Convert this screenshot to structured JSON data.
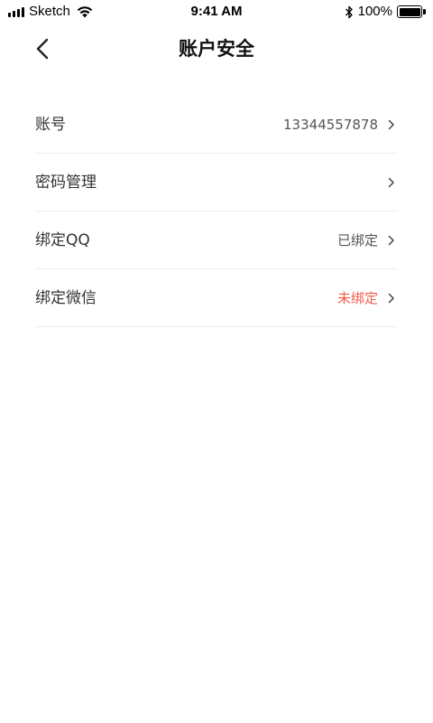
{
  "status_bar": {
    "carrier": "Sketch",
    "time": "9:41 AM",
    "battery": "100%",
    "icons": [
      "signal-icon",
      "wifi-icon",
      "bluetooth-icon",
      "battery-icon"
    ]
  },
  "nav": {
    "back_icon": "back-chevron-icon",
    "title": "账户安全"
  },
  "rows": [
    {
      "label": "账号",
      "value": "13344557878",
      "icon": "chevron-right-icon"
    },
    {
      "label": "密码管理",
      "value": "",
      "icon": "chevron-right-icon"
    },
    {
      "label": "绑定QQ",
      "value": "已绑定",
      "icon": "chevron-right-icon"
    },
    {
      "label": "绑定微信",
      "value": "未绑定",
      "icon": "chevron-right-icon"
    }
  ],
  "colors": {
    "unbound_text": "#f25a4b",
    "divider": "#ececf2"
  }
}
